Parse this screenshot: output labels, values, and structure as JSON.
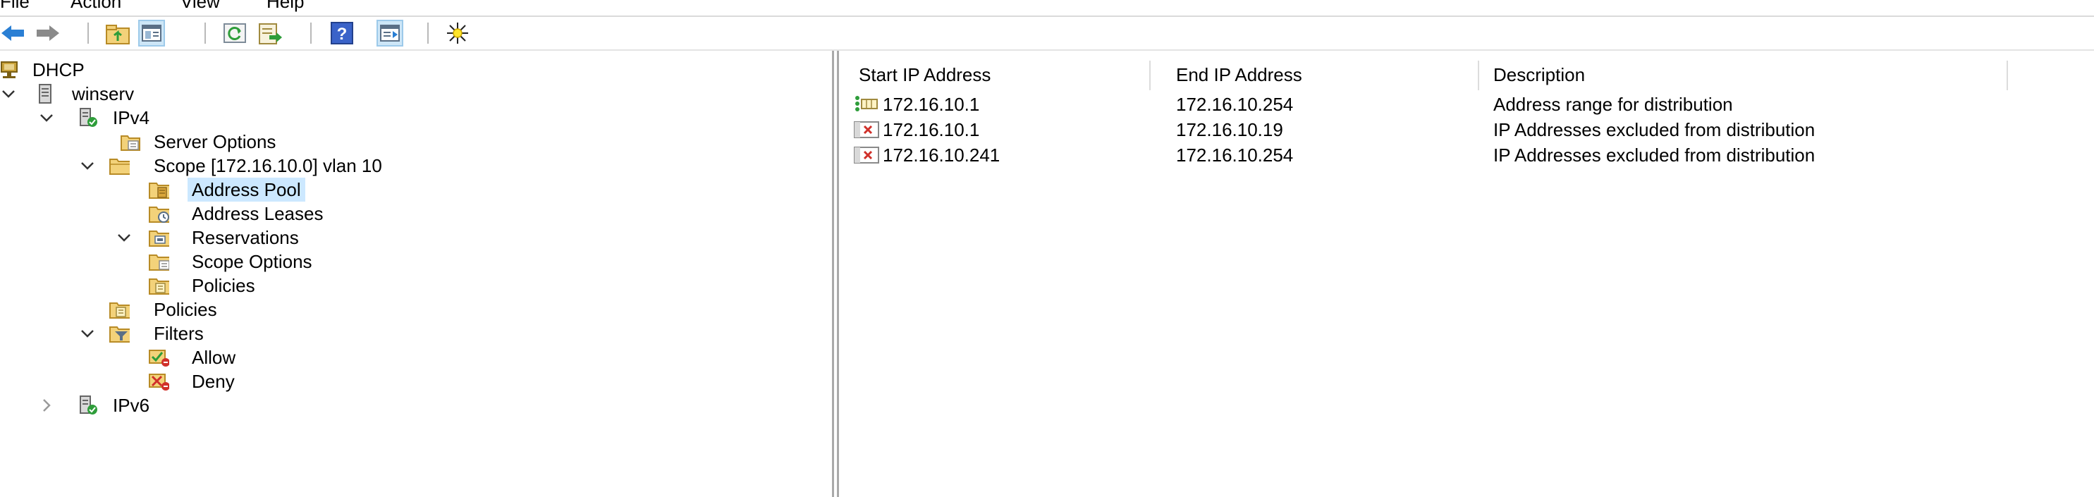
{
  "menu": [
    "File",
    "Action",
    "View",
    "Help"
  ],
  "toolbar": {
    "buttons": [
      {
        "name": "back-button",
        "icon": "back-arrow-icon",
        "enabled": true
      },
      {
        "name": "forward-button",
        "icon": "forward-arrow-icon",
        "enabled": true
      },
      {
        "name": "up-level-button",
        "icon": "folder-up-icon",
        "enabled": true
      },
      {
        "name": "show-hide-console-tree-button",
        "icon": "console-tree-icon",
        "enabled": true
      },
      {
        "name": "refresh-button",
        "icon": "refresh-icon",
        "enabled": true
      },
      {
        "name": "export-list-button",
        "icon": "export-list-icon",
        "enabled": true
      },
      {
        "name": "help-button",
        "icon": "help-icon",
        "enabled": true
      },
      {
        "name": "show-action-pane-button",
        "icon": "action-pane-icon",
        "enabled": true
      },
      {
        "name": "new-exclusion-range-button",
        "icon": "sparkle-icon",
        "enabled": true
      }
    ]
  },
  "tree": {
    "root": "DHCP",
    "server": "winserv",
    "ipv4": "IPv4",
    "server_options": "Server Options",
    "scope": "Scope [172.16.10.0] vlan 10",
    "address_pool": "Address Pool",
    "address_leases": "Address Leases",
    "reservations": "Reservations",
    "scope_options": "Scope Options",
    "scope_policies": "Policies",
    "policies": "Policies",
    "filters": "Filters",
    "allow": "Allow",
    "deny": "Deny",
    "ipv6": "IPv6",
    "selected": "Address Pool"
  },
  "list": {
    "columns": [
      "Start IP Address",
      "End IP Address",
      "Description"
    ],
    "rows": [
      {
        "icon": "address-range-icon",
        "start": "172.16.10.1",
        "end": "172.16.10.254",
        "description": "Address range for distribution"
      },
      {
        "icon": "exclusion-icon",
        "start": "172.16.10.1",
        "end": "172.16.10.19",
        "description": "IP Addresses excluded from distribution"
      },
      {
        "icon": "exclusion-icon",
        "start": "172.16.10.241",
        "end": "172.16.10.254",
        "description": "IP Addresses excluded from distribution"
      }
    ]
  },
  "colors": {
    "selection": "#cce8ff",
    "pressed_button": "#cde6f7",
    "folder": "#f3d27a",
    "accent_green": "#2e9d3a",
    "accent_red": "#d0302a"
  }
}
